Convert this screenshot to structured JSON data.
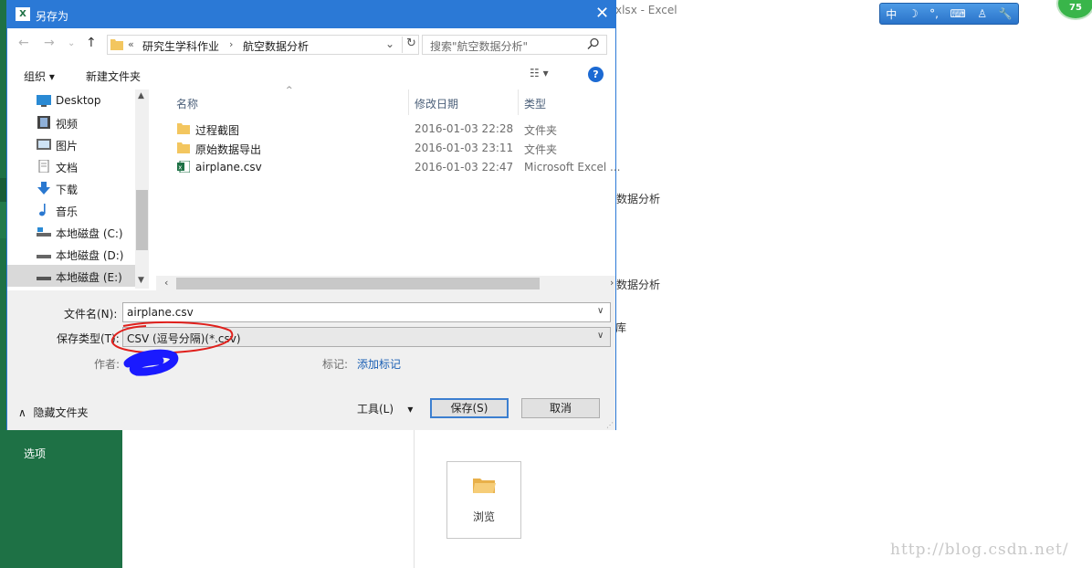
{
  "background": {
    "window_title": "xlsx - Excel",
    "sidebar_item": "选项",
    "recent_1": "数据分析",
    "recent_2": "数据分析",
    "recent_3": "库",
    "browse_label": "浏览",
    "badge_value": "75",
    "watermark": "http://blog.csdn.net/",
    "ime": {
      "mode": "中"
    }
  },
  "dialog": {
    "title": "另存为",
    "app_icon": "X",
    "address": {
      "overflow": "«",
      "segment1": "研究生学科作业",
      "segment2": "航空数据分析"
    },
    "search_placeholder": "搜索\"航空数据分析\"",
    "toolbar": {
      "organize": "组织 ▾",
      "new_folder": "新建文件夹"
    },
    "nav_items": [
      {
        "label": "Desktop",
        "icon": "desktop-icon"
      },
      {
        "label": "视频",
        "icon": "video-icon"
      },
      {
        "label": "图片",
        "icon": "pictures-icon"
      },
      {
        "label": "文档",
        "icon": "document-icon"
      },
      {
        "label": "下载",
        "icon": "download-icon"
      },
      {
        "label": "音乐",
        "icon": "music-icon"
      },
      {
        "label": "本地磁盘 (C:)",
        "icon": "drive-icon"
      },
      {
        "label": "本地磁盘 (D:)",
        "icon": "drive-icon"
      },
      {
        "label": "本地磁盘 (E:)",
        "icon": "drive-icon",
        "selected": true
      }
    ],
    "columns": {
      "name": "名称",
      "modified": "修改日期",
      "type": "类型"
    },
    "files": [
      {
        "name": "过程截图",
        "modified": "2016-01-03 22:28",
        "type": "文件夹",
        "icon": "folder-icon"
      },
      {
        "name": "原始数据导出",
        "modified": "2016-01-03 23:11",
        "type": "文件夹",
        "icon": "folder-icon"
      },
      {
        "name": "airplane.csv",
        "modified": "2016-01-03 22:47",
        "type": "Microsoft Excel ...",
        "icon": "excel-file-icon"
      }
    ],
    "form": {
      "filename_label": "文件名(N):",
      "filename_value": "airplane.csv",
      "filetype_label": "保存类型(T):",
      "filetype_value": "CSV (逗号分隔)(*.csv)",
      "author_label": "作者:",
      "tags_label": "标记:",
      "tags_link": "添加标记",
      "hide_folders": "隐藏文件夹",
      "tools": "工具(L)",
      "save": "保存(S)",
      "cancel": "取消"
    },
    "colors": {
      "title_bar": "#2b79d6",
      "excel_green": "#1e7145",
      "annotation_red": "#e0201c",
      "redaction_blue": "#1a1aff"
    }
  }
}
